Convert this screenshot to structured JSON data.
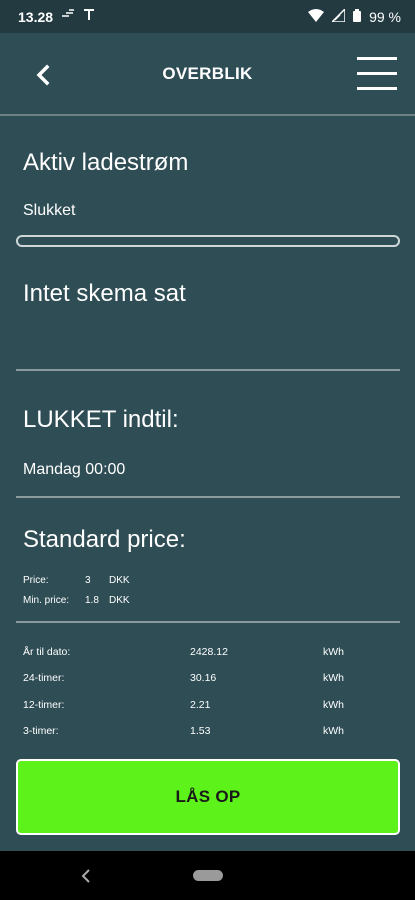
{
  "status_bar": {
    "time": "13.28",
    "battery": "99 %"
  },
  "header": {
    "title": "OVERBLIK"
  },
  "charging": {
    "title": "Aktiv ladestrøm",
    "status": "Slukket",
    "progress": 0
  },
  "schedule": {
    "title": "Intet skema sat"
  },
  "locked": {
    "title": "LUKKET indtil:",
    "until": "Mandag 00:00"
  },
  "price": {
    "title": "Standard price:",
    "rows": [
      {
        "label": "Price:",
        "value": "3",
        "unit": "DKK"
      },
      {
        "label": "Min. price:",
        "value": "1.8",
        "unit": "DKK"
      }
    ]
  },
  "stats": [
    {
      "label": "År til dato:",
      "value": "2428.12",
      "unit": "kWh"
    },
    {
      "label": "24-timer:",
      "value": "30.16",
      "unit": "kWh"
    },
    {
      "label": "12-timer:",
      "value": "2.21",
      "unit": "kWh"
    },
    {
      "label": "3-timer:",
      "value": "1.53",
      "unit": "kWh"
    }
  ],
  "unlock_button": {
    "label": "LÅS OP"
  },
  "colors": {
    "background": "#2f4d55",
    "accent_green": "#5df21a"
  }
}
